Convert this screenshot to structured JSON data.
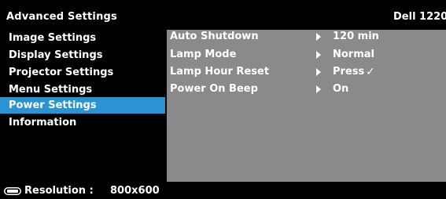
{
  "header": {
    "title": "Advanced Settings",
    "model": "Dell 1220"
  },
  "sidebar": {
    "items": [
      {
        "label": "Image Settings",
        "active": false
      },
      {
        "label": "Display Settings",
        "active": false
      },
      {
        "label": "Projector Settings",
        "active": false
      },
      {
        "label": "Menu Settings",
        "active": false
      },
      {
        "label": "Power Settings",
        "active": true
      },
      {
        "label": "Information",
        "active": false
      }
    ]
  },
  "panel": {
    "rows": [
      {
        "label": "Auto Shutdown",
        "value": "120 min"
      },
      {
        "label": "Lamp Mode",
        "value": "Normal"
      },
      {
        "label": "Lamp Hour Reset",
        "value": "Press"
      },
      {
        "label": "Power On Beep",
        "value": "On"
      }
    ],
    "check_mark": "✓"
  },
  "footer": {
    "icon": "resolution-icon",
    "label": "Resolution :",
    "value": "800x600"
  },
  "colors": {
    "background": "#000000",
    "panel": "#8a8a8a",
    "selection": "#2c93d2",
    "text": "#ffffff"
  }
}
